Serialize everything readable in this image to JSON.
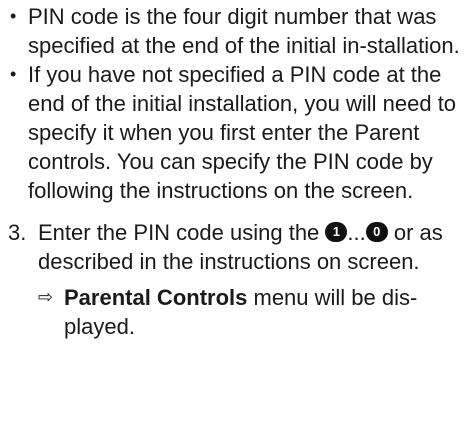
{
  "notes": [
    {
      "bullet": "•",
      "text": "PIN code is the four digit number that was specified at the end of the initial in-stallation."
    },
    {
      "bullet": "•",
      "text": "If you have not specified a PIN code at the end of the initial installation, you will need to specify it when you first enter the Parent controls. You can specify the PIN code by following the instructions on the screen."
    }
  ],
  "step": {
    "number": "3.",
    "text_before": "Enter the PIN code using the ",
    "key_first": "1",
    "key_separator": "...",
    "key_last": "0",
    "text_after": " or as described in the instructions on screen."
  },
  "result": {
    "arrow": "⇨",
    "menu_name": "Parental Controls",
    "text": " menu will be dis-played."
  }
}
